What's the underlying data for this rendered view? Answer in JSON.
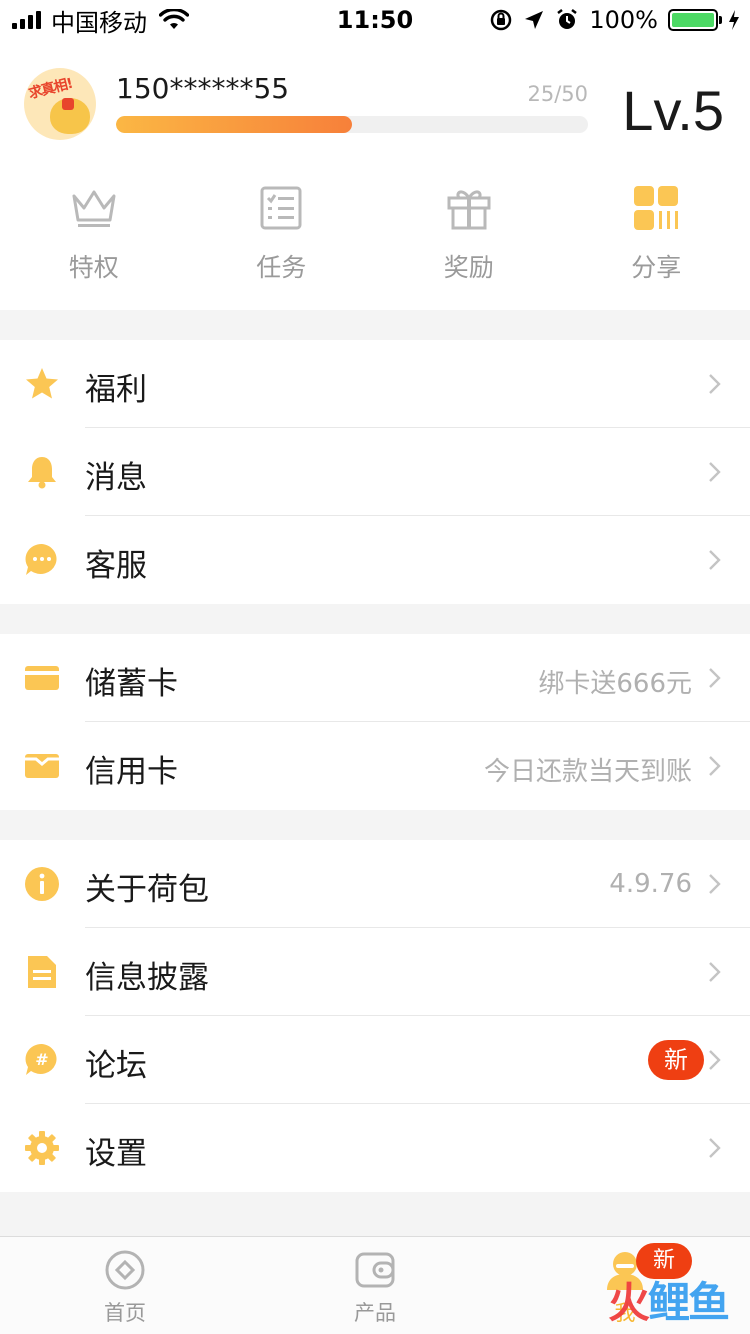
{
  "status_bar": {
    "carrier": "中国移动",
    "time": "11:50",
    "battery": "100%",
    "battery_level": 1.0
  },
  "profile": {
    "user_id": "150******55",
    "exp": "25/50",
    "exp_fraction": 0.5,
    "level": "Lv.5",
    "avatar_text": "求真相!"
  },
  "quick_actions": [
    {
      "label": "特权",
      "icon": "crown-icon"
    },
    {
      "label": "任务",
      "icon": "checklist-icon"
    },
    {
      "label": "奖励",
      "icon": "gift-icon"
    },
    {
      "label": "分享",
      "icon": "qr-grid-icon"
    }
  ],
  "groups": {
    "group1": [
      {
        "label": "福利",
        "icon": "star-icon"
      },
      {
        "label": "消息",
        "icon": "bell-icon"
      },
      {
        "label": "客服",
        "icon": "chat-bubble-icon"
      }
    ],
    "group2": [
      {
        "label": "储蓄卡",
        "icon": "debit-card-icon",
        "value": "绑卡送666元"
      },
      {
        "label": "信用卡",
        "icon": "credit-card-icon",
        "value": "今日还款当天到账"
      }
    ],
    "group3": [
      {
        "label": "关于荷包",
        "icon": "info-icon",
        "value": "4.9.76"
      },
      {
        "label": "信息披露",
        "icon": "document-icon"
      },
      {
        "label": "论坛",
        "icon": "hashtag-bubble-icon",
        "badge": "新"
      },
      {
        "label": "设置",
        "icon": "gear-icon"
      }
    ]
  },
  "tabbar": {
    "tabs": [
      {
        "label": "首页",
        "icon": "home-target-icon"
      },
      {
        "label": "产品",
        "icon": "wallet-icon"
      },
      {
        "label": "我",
        "icon": "user-icon",
        "badge": "新"
      }
    ]
  },
  "watermark": {
    "part1": "火",
    "part2": "鲤鱼"
  },
  "colors": {
    "accent": "#F7B731",
    "accent_orange": "#F7803A",
    "badge_red": "#EF3F12",
    "text_primary": "#1A1A1A",
    "text_secondary": "#9A9A9A"
  }
}
